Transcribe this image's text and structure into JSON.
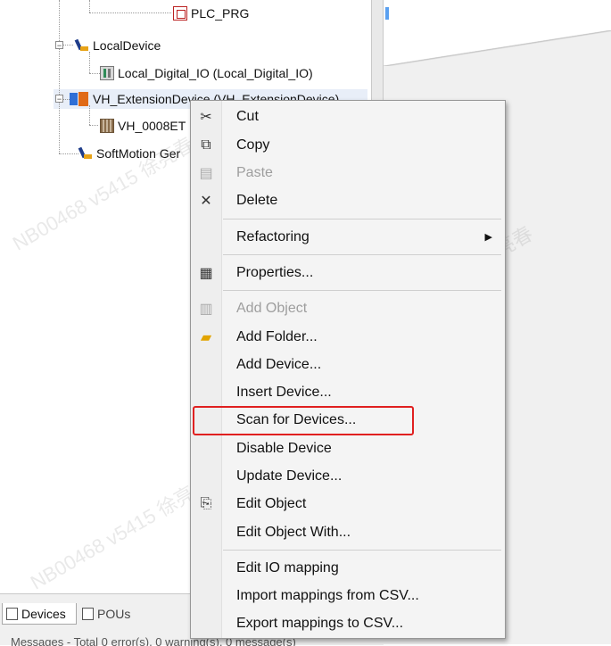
{
  "tree": {
    "items": [
      {
        "label": "PLC_PRG"
      },
      {
        "label": "LocalDevice"
      },
      {
        "label": "Local_Digital_IO (Local_Digital_IO)"
      },
      {
        "label": "VH_ExtensionDevice (VH_ExtensionDevice)"
      },
      {
        "label": "VH_0008ET"
      },
      {
        "label": "SoftMotion Ger"
      }
    ]
  },
  "context_menu": {
    "items": [
      {
        "label": "Cut",
        "icon": "scissors-icon",
        "enabled": true
      },
      {
        "label": "Copy",
        "icon": "copy-icon",
        "enabled": true
      },
      {
        "label": "Paste",
        "icon": "paste-icon",
        "enabled": false
      },
      {
        "label": "Delete",
        "icon": "delete-icon",
        "enabled": true
      },
      {
        "label": "Refactoring",
        "has_submenu": true,
        "enabled": true
      },
      {
        "label": "Properties...",
        "icon": "properties-icon",
        "enabled": true
      },
      {
        "label": "Add Object",
        "icon": "add-object-icon",
        "enabled": false
      },
      {
        "label": "Add Folder...",
        "icon": "folder-icon",
        "enabled": true
      },
      {
        "label": "Add Device...",
        "enabled": true
      },
      {
        "label": "Insert Device...",
        "enabled": true
      },
      {
        "label": "Scan for Devices...",
        "enabled": true,
        "highlighted": true
      },
      {
        "label": "Disable Device",
        "enabled": true
      },
      {
        "label": "Update Device...",
        "enabled": true
      },
      {
        "label": "Edit Object",
        "icon": "edit-object-icon",
        "enabled": true
      },
      {
        "label": "Edit Object With...",
        "enabled": true
      },
      {
        "label": "Edit IO mapping",
        "enabled": true
      },
      {
        "label": "Import mappings from CSV...",
        "enabled": true
      },
      {
        "label": "Export mappings to CSV...",
        "enabled": true
      }
    ]
  },
  "bottom_tabs": [
    {
      "label": "Devices",
      "active": true
    },
    {
      "label": "POUs",
      "active": false
    }
  ],
  "messages_bar": {
    "text": "Messages - Total 0 error(s), 0 warning(s), 0 message(s)"
  },
  "watermark": {
    "lines": [
      "NB00468 v5415 徐亮春",
      "NB00468 v5415 徐亮春",
      "NB00468 v5415 徐亮春"
    ]
  },
  "colors": {
    "highlight_border": "#e02020",
    "menu_bg": "#f4f4f4",
    "selection_bg": "#e8eef8"
  }
}
